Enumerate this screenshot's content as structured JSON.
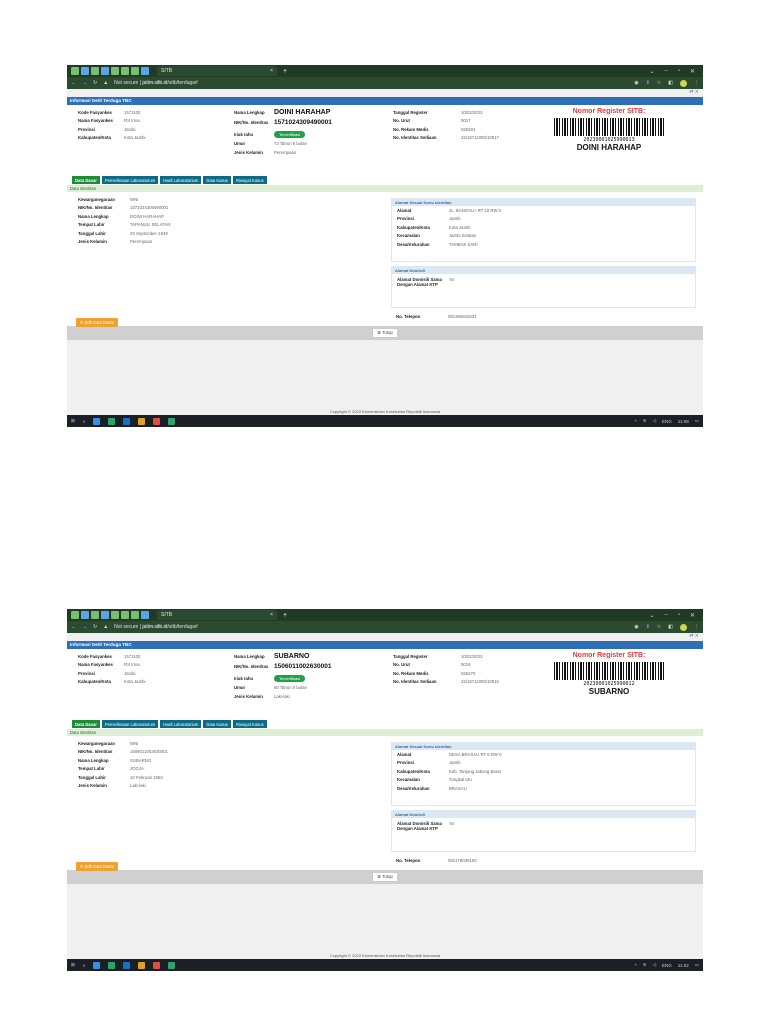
{
  "browser": {
    "tab_title": "SITB",
    "tab_close": "×",
    "new_tab": "+",
    "url_prefix": "Not secure |",
    "url_domain": "jatim.sitb.id",
    "url_path": "/sitb/terduga#"
  },
  "page": {
    "header": "Informasi Detil Terduga TBC",
    "labels": {
      "kode_faskes": "Kode Fasyankes",
      "nama_faskes": "Nama Fasyankes",
      "provinsi": "Provinsi",
      "kabupaten": "Kabupaten/Kota",
      "nama_lengkap": "Nama Lengkap",
      "nik": "NIK/No. Identitas",
      "iriak_tahu": "Iriak tahu",
      "umur": "Umur",
      "jenis_kelamin": "Jenis Kelamin",
      "tanggal_register": "Tanggal Register",
      "no_urut": "No. Urut",
      "no_rekam_medis": "No. Rekam Medis",
      "no_identitas_sediaan": "No. Identitas Sediaan",
      "nomor_register_title": "Nomor Register SITB:"
    },
    "badge_label": "Terverifikasi",
    "tabs": [
      "Data Dasar",
      "Pemeriksaan Laboratorium",
      "Hasil Laboratorium",
      "Data Kasus",
      "Riwayat Kasus"
    ],
    "section_label": "Data Identitas",
    "identity_labels": {
      "kewarganegaraan": "Kewarganegaraan",
      "nik": "NIK/No. Identitas",
      "nama": "Nama Lengkap",
      "tempat_lahir": "Tempat Lahir",
      "tanggal_lahir": "Tanggal Lahir",
      "jenis_kelamin": "Jenis Kelamin"
    },
    "address_header": "Alamat Sesuai Kartu Identitas",
    "address_labels": {
      "alamat": "Alamat",
      "provinsi": "Provinsi",
      "kabupaten": "Kabupaten/Kota",
      "kecamatan": "Kecamatan",
      "desa": "Desa/Kelurahan"
    },
    "domisili_header": "Alamat Domisili",
    "domisili_label": "Alamat Domisili Sama Dengan Alamat KTP",
    "telepon_label": "No. Telepon",
    "edit_button": "Edit Data Dasar",
    "close_button": "Tutup",
    "copyright": "Copyright © 2023 Kementerian Kesehatan Republik Indonesia",
    "topright_icons": "⇄ ✕"
  },
  "records": [
    {
      "kode_faskes": "1571100",
      "nama_faskes": "RS Irma",
      "provinsi": "Jambi",
      "kabupaten": "Kota Jambi",
      "nama_lengkap": "DOINI HARAHAP",
      "nik": "1571024309490001",
      "umur": "73 Tahun 5 bulan",
      "jenis_kelamin": "Perempuan",
      "tanggal_register": "10/02/2023",
      "no_urut": "0017",
      "no_rekam_medis": "026281",
      "no_identitas_sediaan": "23/15711000/10017",
      "barcode_number": "20230001025990013",
      "barcode_name": "DOINI HARAHAP",
      "kewarganegaraan": "WNI",
      "tempat_lahir": "TAPANULI SELATAN",
      "tanggal_lahir": "03 September 1949",
      "alamat": "JL. BANGAU I RT 10 RW 0",
      "prov_alamat": "Jambi",
      "kab_alamat": "Kota Jambi",
      "kecamatan": "Jambi Selatan",
      "desa": "TAMBAK SARI",
      "domisili": "Ya",
      "telepon": "081366818234",
      "time": "11:08"
    },
    {
      "kode_faskes": "1571100",
      "nama_faskes": "RS Irma",
      "provinsi": "Jambi",
      "kabupaten": "Kota Jambi",
      "nama_lengkap": "SUBARNO",
      "nik": "1506011002630001",
      "umur": "60 Tahun 0 bulan",
      "jenis_kelamin": "Laki-laki",
      "tanggal_register": "10/02/2023",
      "no_urut": "0016",
      "no_rekam_medis": "026270",
      "no_identitas_sediaan": "23/15711000/10016",
      "barcode_number": "20230001025990012",
      "barcode_name": "SUBARNO",
      "kewarganegaraan": "WNI",
      "tempat_lahir": "JOGJA",
      "tanggal_lahir": "10 Februari 1963",
      "alamat": "DESA BRASAU RT 6 RW 0",
      "prov_alamat": "Jambi",
      "kab_alamat": "Kab. Tanjung Jabung Barat",
      "kecamatan": "Tungkal Ulu",
      "desa": "BRASAU",
      "domisili": "Ya",
      "telepon": "082178039100",
      "time": "11:02"
    }
  ],
  "taskbar": {
    "lang": "ENG"
  }
}
